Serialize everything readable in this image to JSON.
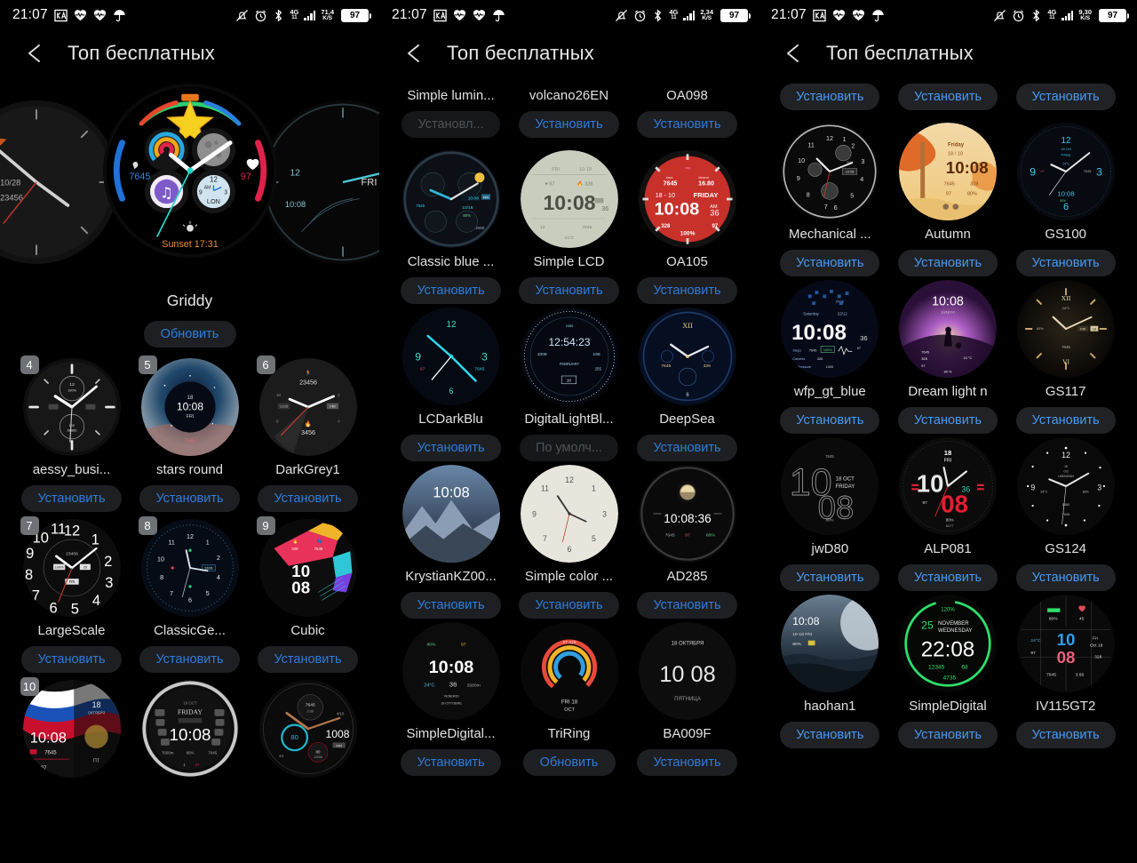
{
  "statusbar": {
    "time": "21:07",
    "battery": "97",
    "network_type": "4G",
    "left_icons": [
      "ka-logo-icon",
      "heart-rate-icon",
      "heart-rate-icon",
      "umbrella-icon"
    ],
    "right_icons": [
      "silent-mode-icon",
      "alarm-icon",
      "bluetooth-icon",
      "signal-icon",
      "battery-icon"
    ],
    "speeds": [
      "71,4",
      "2,34",
      "9,30"
    ],
    "speed_unit": "K/S"
  },
  "header": {
    "title": "Топ бесплатных",
    "back_icon": "back-arrow-icon"
  },
  "labels": {
    "install": "Установить",
    "update": "Обновить",
    "installed": "Установл...",
    "default": "По умолч..."
  },
  "panel1": {
    "featured": {
      "name": "Griddy",
      "button": "Обновить",
      "button_state": "update",
      "readouts": {
        "steps": "7645",
        "heart_rate": "97",
        "sunset_label": "Sunset",
        "sunset_time": "17:31",
        "subdial_city": "LON",
        "subdial_ampm": "AM",
        "subdial_12": "12",
        "subdial_3": "3",
        "subdial_9": "9"
      }
    },
    "items": [
      {
        "rank": "4",
        "name": "aessy_busi...",
        "button": "Установить",
        "state": "install",
        "readouts": {
          "time": "10:08",
          "steps": "7645",
          "battery": "100%"
        }
      },
      {
        "rank": "5",
        "name": "stars round",
        "button": "Установить",
        "state": "install",
        "readouts": {
          "time": "10:08",
          "date": "18",
          "weekday": "FRI",
          "steps": "7645"
        }
      },
      {
        "rank": "6",
        "name": "DarkGrey1",
        "button": "Установить",
        "state": "install",
        "readouts": {
          "steps": "23456",
          "calories": "3456",
          "weekday": "FRI",
          "date": "10/28"
        }
      },
      {
        "rank": "7",
        "name": "LargeScale",
        "button": "Установить",
        "state": "install",
        "readouts": {
          "steps": "23456",
          "battery": "100%",
          "date": "25",
          "weekday": "FRI"
        }
      },
      {
        "rank": "8",
        "name": "ClassicGe...",
        "button": "Установить",
        "state": "install",
        "readouts": {
          "date": "12/31"
        }
      },
      {
        "rank": "9",
        "name": "Cubic",
        "button": "Установить",
        "state": "install",
        "readouts": {
          "hours": "10",
          "minutes": "08",
          "calories": "328",
          "steps": "7645"
        }
      },
      {
        "rank": "10",
        "name": "",
        "button": "",
        "state": "partial",
        "readouts": {
          "time": "10:08",
          "date": "18",
          "month": "ОКТЯБРЯ",
          "steps": "7645",
          "heart_rate": "97",
          "weekday": "ПТ"
        }
      },
      {
        "rank": "",
        "name": "",
        "button": "",
        "state": "partial",
        "readouts": {
          "time": "10:08",
          "weekday": "FRIDAY",
          "date": "18 OCT",
          "distance": "7600m",
          "battery": "80%",
          "steps": "7645"
        }
      },
      {
        "rank": "",
        "name": "",
        "button": "",
        "state": "partial",
        "readouts": {
          "time": "1008",
          "steps": "7645",
          "pressure": "80",
          "weekday": "FRI",
          "date": "4/18"
        }
      }
    ]
  },
  "panel2": {
    "top_row": [
      {
        "name": "Simple lumin...",
        "button": "Установл...",
        "state": "installed"
      },
      {
        "name": "volcano26EN",
        "button": "Установить",
        "state": "install"
      },
      {
        "name": "OA098",
        "button": "Установить",
        "state": "install"
      }
    ],
    "items": [
      {
        "name": "Classic blue ...",
        "button": "Установить",
        "state": "install",
        "readouts": {
          "time": "10:08",
          "date": "10/18",
          "weekday": "FRI",
          "battery": "80%",
          "steps": "7645",
          "distance": "2680"
        }
      },
      {
        "name": "Simple LCD",
        "button": "Установить",
        "state": "install",
        "readouts": {
          "time": "10:08",
          "seconds": "36",
          "weekday": "FRI",
          "date": "10-18",
          "heart_rate": "97",
          "calories": "328",
          "steps": "7645",
          "temp": "24°C",
          "floors": "12"
        }
      },
      {
        "name": "OA105",
        "button": "Установить",
        "state": "install",
        "readouts": {
          "time": "10:08",
          "seconds": "36",
          "ampm": "AM",
          "date": "18 - 10",
          "weekday": "FRIDAY",
          "steps": "7645",
          "distance": "16.80",
          "calories": "328",
          "heart_rate": "97",
          "battery": "100%"
        }
      },
      {
        "name": "LCDarkBlu",
        "button": "Установить",
        "state": "install",
        "readouts": {
          "heart_rate": "97",
          "steps": "7645",
          "left": "9",
          "right": "3",
          "top": "12"
        }
      },
      {
        "name": "DigitalLightBl...",
        "button": "По умолч...",
        "state": "default",
        "readouts": {
          "time": "12:54:23",
          "steps": "1008",
          "distance": "198",
          "month": "FEBRUARY",
          "calories": "255"
        }
      },
      {
        "name": "DeepSea",
        "button": "Установить",
        "state": "install",
        "readouts": {
          "roman_12": "XII",
          "steps": "7645",
          "heart_rate": "328",
          "marker": "6"
        }
      },
      {
        "name": "KrystianKZ00...",
        "button": "Установить",
        "state": "install",
        "readouts": {
          "time": "10:08"
        }
      },
      {
        "name": "Simple color ...",
        "button": "Установить",
        "state": "install",
        "readouts": {
          "top": "12",
          "left": "9",
          "right": "3",
          "bottom": "6"
        }
      },
      {
        "name": "AD285",
        "button": "Установить",
        "state": "install",
        "readouts": {
          "time": "10:08:36",
          "steps": "7645",
          "heart_rate": "97",
          "battery": "80%"
        }
      },
      {
        "name": "SimpleDigital...",
        "button": "Установить",
        "state": "install",
        "readouts": {
          "time": "10:08",
          "seconds": "36",
          "temp": "24°C",
          "battery": "80%",
          "steps": "2680m",
          "weekday": "VENERDI",
          "date": "18 OTTOBRE"
        }
      },
      {
        "name": "TriRing",
        "button": "Обновить",
        "state": "update",
        "readouts": {
          "heart_rate": "97",
          "calories": "328",
          "weekday": "FRI",
          "date": "18 OCT"
        }
      },
      {
        "name": "BA009F",
        "button": "Установить",
        "state": "install",
        "readouts": {
          "hours": "10",
          "minutes": "08",
          "date": "18 ОКТЯБРЯ",
          "weekday": "ПЯТНИЦА"
        }
      }
    ]
  },
  "panel3": {
    "top_buttons": [
      "Установить",
      "Установить",
      "Установить"
    ],
    "items": [
      {
        "name": "Mechanical ...",
        "button": "Установить",
        "state": "install",
        "readouts": {
          "time": "10:08",
          "steps": "7645",
          "top": "12",
          "left": "9",
          "right": "3",
          "bottom": "6"
        }
      },
      {
        "name": "Autumn",
        "button": "Установить",
        "state": "install",
        "readouts": {
          "time": "10:08",
          "weekday": "Friday",
          "date": "18 / 10",
          "steps": "7645",
          "calories": "328",
          "heart_rate": "97",
          "battery": "80%"
        }
      },
      {
        "name": "GS100",
        "button": "Установить",
        "state": "install",
        "readouts": {
          "time": "10:08",
          "date": "18 Oct",
          "weekday": "Friday",
          "temp": "24°C",
          "heart_rate": "97",
          "steps": "7645",
          "battery": "80%"
        }
      },
      {
        "name": "wfp_gt_blue",
        "button": "Установить",
        "state": "install",
        "readouts": {
          "time": "10:08",
          "seconds": "36",
          "weekday": "Saturday",
          "date": "22/12",
          "temp": "24°C",
          "steps": "7645",
          "battery": "100%",
          "heart_rate": "97",
          "calories": "328",
          "pressure": "1000"
        }
      },
      {
        "name": "Dream light n",
        "button": "Установить",
        "state": "install",
        "readouts": {
          "time": "10:08",
          "date": "10/18",
          "weekday": "Fri",
          "steps": "7645",
          "calories": "328",
          "heart_rate": "97",
          "temp": "24 °C",
          "battery": "80 %"
        }
      },
      {
        "name": "GS117",
        "button": "Установить",
        "state": "install",
        "readouts": {
          "roman_12": "XII",
          "roman_6": "VI",
          "temp": "24°C",
          "battery": "80%",
          "weekday": "FRI",
          "date": "18",
          "steps": "7645"
        }
      },
      {
        "name": "jwD80",
        "button": "Установить",
        "state": "install",
        "readouts": {
          "hours": "10",
          "minutes": "08",
          "date": "18 OCT",
          "weekday": "FRIDAY",
          "steps": "7645",
          "battery": "80%"
        }
      },
      {
        "name": "ALP081",
        "button": "Установить",
        "state": "install",
        "readouts": {
          "hours": "10",
          "minutes": "08",
          "seconds": "36",
          "date": "18",
          "weekday": "FRI",
          "heart_rate": "97",
          "battery": "80%",
          "batt_label": "BATT"
        }
      },
      {
        "name": "GS124",
        "button": "Установить",
        "state": "install",
        "readouts": {
          "top": "12",
          "left": "9",
          "right": "3",
          "temp": "24°C",
          "battery": "80%",
          "date": "18 Oct",
          "weekday": "UNKNOWN",
          "distance": "2680",
          "steps": "7645"
        }
      },
      {
        "name": "haohan1",
        "button": "Установить",
        "state": "install",
        "readouts": {
          "time": "10:08",
          "date": "10-18",
          "weekday": "FRI",
          "battery": "80%"
        }
      },
      {
        "name": "SimpleDigital",
        "button": "Установить",
        "state": "install",
        "readouts": {
          "time": "22:08",
          "date": "25",
          "month": "NOVEMBER",
          "weekday": "WEDNESDAY",
          "battery": "120%",
          "steps": "12345",
          "heart_rate": "68",
          "calories": "4735"
        }
      },
      {
        "name": "IV115GT2",
        "button": "Установить",
        "state": "install",
        "readouts": {
          "hours": "10",
          "minutes": "08",
          "weekday": "Fri",
          "date": "Oct 18",
          "temp": "24°C",
          "heart_rate": "97",
          "hr_alt": "45",
          "calories": "328",
          "steps": "7645",
          "distance": "3.66",
          "battery": "80%"
        }
      }
    ]
  },
  "colors": {
    "accent_blue": "#3b8ef0",
    "accent_blue_dim": "#2e7ddc",
    "pill_bg": "#1d1f22",
    "pill_bg_disabled": "#161719",
    "text_primary": "#e6e6e6",
    "background": "#000000",
    "rank_badge": "#6e7276"
  }
}
